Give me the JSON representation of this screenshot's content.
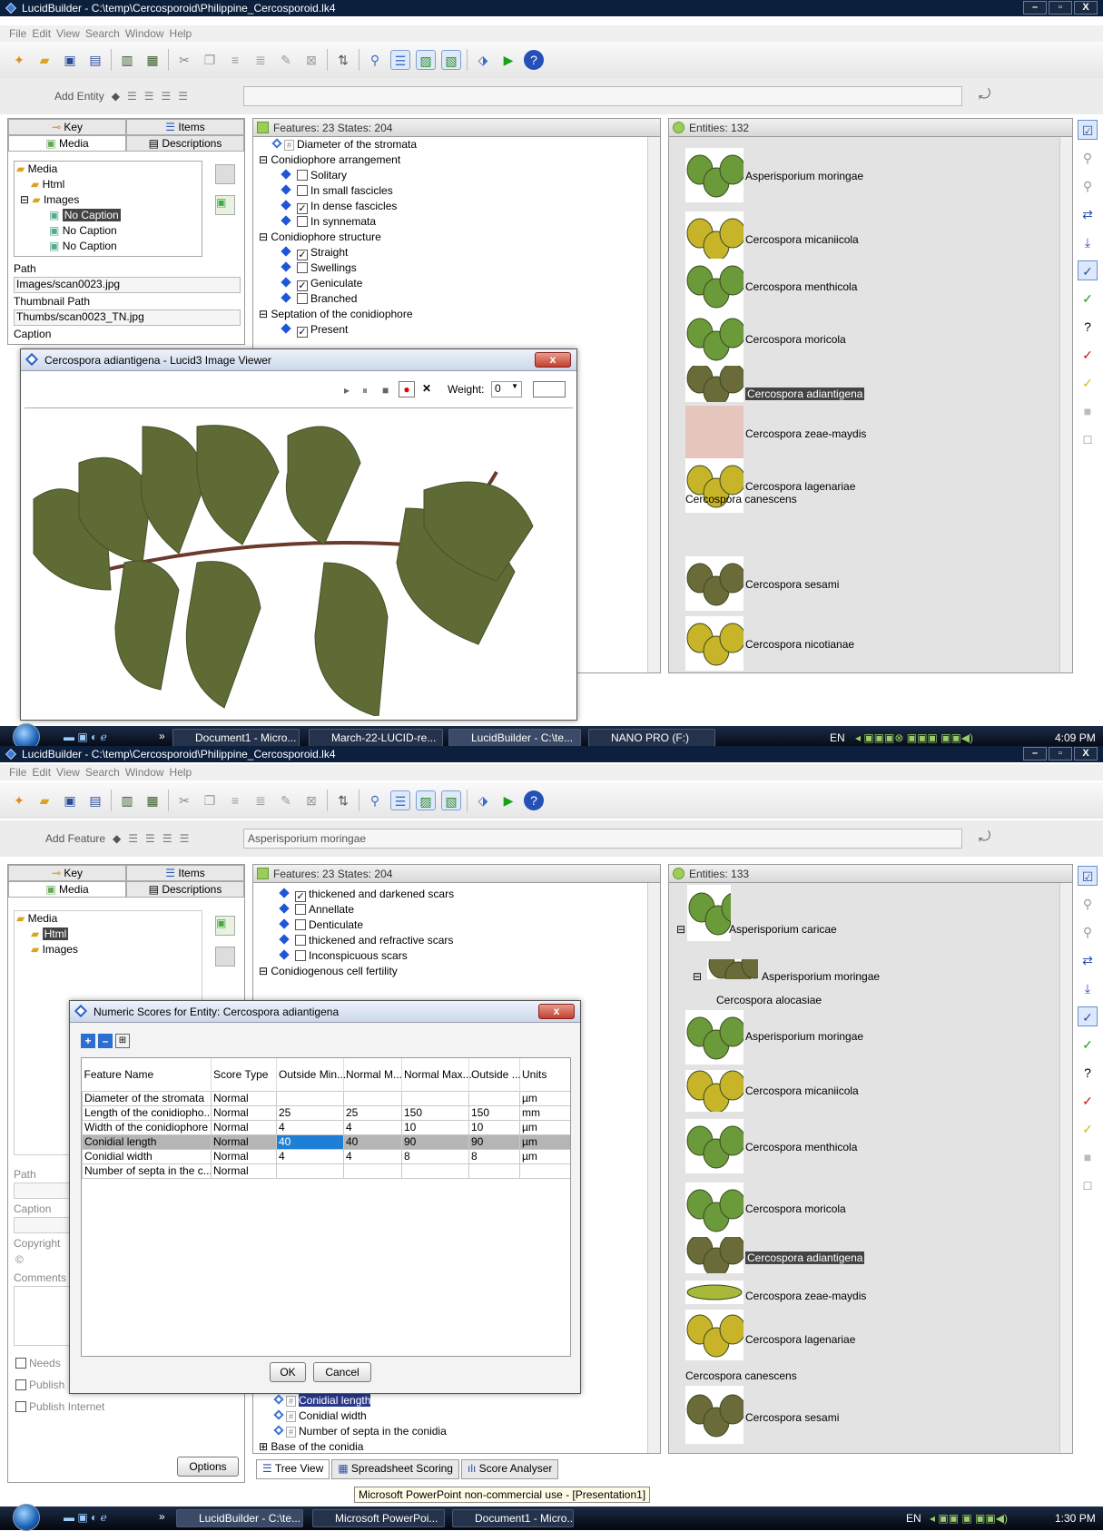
{
  "top": {
    "title": "LucidBuilder - C:\\temp\\Cercosporoid\\Philippine_Cercosporoid.lk4",
    "menu": [
      "File",
      "Edit",
      "View",
      "Search",
      "Window",
      "Help"
    ],
    "entity_bar_label": "Add Entity",
    "left_tabs": {
      "key": "Key",
      "items": "Items",
      "media": "Media",
      "descriptions": "Descriptions"
    },
    "media_tree": [
      "Media",
      "Html",
      "Images",
      "No Caption",
      "No Caption",
      "No Caption"
    ],
    "path_label": "Path",
    "path_value": "Images/scan0023.jpg",
    "thumb_label": "Thumbnail Path",
    "thumb_value": "Thumbs/scan0023_TN.jpg",
    "caption_label": "Caption",
    "features_header": "Features: 23 States: 204",
    "features": [
      {
        "t": "Diameter of the stromata",
        "kind": "numeric",
        "lvl": 1
      },
      {
        "t": "Conidiophore arrangement",
        "kind": "group",
        "lvl": 0
      },
      {
        "t": "Solitary",
        "kind": "state",
        "checked": false,
        "lvl": 2
      },
      {
        "t": "In small fascicles",
        "kind": "state",
        "checked": false,
        "lvl": 2
      },
      {
        "t": "In dense fascicles",
        "kind": "state",
        "checked": true,
        "lvl": 2
      },
      {
        "t": "In synnemata",
        "kind": "state",
        "checked": false,
        "lvl": 2
      },
      {
        "t": "Conidiophore structure",
        "kind": "group",
        "lvl": 0
      },
      {
        "t": "Straight",
        "kind": "state",
        "checked": true,
        "lvl": 2
      },
      {
        "t": "Swellings",
        "kind": "state",
        "checked": false,
        "lvl": 2
      },
      {
        "t": "Geniculate",
        "kind": "state",
        "checked": true,
        "lvl": 2
      },
      {
        "t": "Branched",
        "kind": "state",
        "checked": false,
        "lvl": 2
      },
      {
        "t": "Septation of the conidiophore",
        "kind": "group",
        "lvl": 0
      },
      {
        "t": "Present",
        "kind": "state",
        "checked": true,
        "lvl": 2
      }
    ],
    "entities_header": "Entities: 132",
    "entities": [
      "Asperisporium moringae",
      "Cercospora micaniicola",
      "Cercospora menthicola",
      "Cercospora moricola",
      "Cercospora adiantigena",
      "Cercospora zeae-maydis",
      "Cercospora lagenariae",
      "Cercospora canescens",
      "Cercospora sesami",
      "Cercospora nicotianae"
    ],
    "viewer": {
      "title": "Cercospora adiantigena - Lucid3 Image Viewer",
      "weight_label": "Weight:",
      "weight_value": "0"
    }
  },
  "taskbar1": {
    "items": [
      "Document1 - Micro...",
      "March-22-LUCID-re...",
      "LucidBuilder - C:\\te...",
      "NANO PRO (F:)"
    ],
    "lang": "EN",
    "time": "4:09 PM"
  },
  "bottom": {
    "title": "LucidBuilder - C:\\temp\\Cercosporoid\\Philippine_Cercosporoid.lk4",
    "menu": [
      "File",
      "Edit",
      "View",
      "Search",
      "Window",
      "Help"
    ],
    "feature_bar_label": "Add Feature",
    "feature_bar_value": "Asperisporium moringae",
    "left_tabs": {
      "key": "Key",
      "items": "Items",
      "media": "Media",
      "descriptions": "Descriptions"
    },
    "media_tree": [
      "Media",
      "Html",
      "Images"
    ],
    "path_label": "Path",
    "caption_label": "Caption",
    "copyright_label": "Copyright",
    "copyright_sym": "©",
    "comments_label": "Comments",
    "needs_label": "Needs",
    "publish_label": "Publish",
    "publish_internet": "Publish Internet",
    "options": "Options",
    "features_header": "Features: 23 States: 204",
    "features_top": [
      {
        "t": "thickened and darkened scars",
        "checked": true
      },
      {
        "t": "Annellate",
        "checked": false
      },
      {
        "t": "Denticulate",
        "checked": false
      },
      {
        "t": "thickened and refractive scars",
        "checked": false
      },
      {
        "t": "Inconspicuous scars",
        "checked": false
      }
    ],
    "feature_group": "Conidiogenous cell fertility",
    "features_bottom": [
      "Conidial length",
      "Conidial width",
      "Number of septa in the conidia",
      "Base of the conidia"
    ],
    "bottom_tabs": [
      "Tree View",
      "Spreadsheet Scoring",
      "Score Analyser"
    ],
    "entities_header": "Entities: 133",
    "entities": [
      "Asperisporium caricae",
      "Asperisporium moringae",
      "Cercospora alocasiae",
      "Asperisporium moringae",
      "Cercospora micaniicola",
      "Cercospora menthicola",
      "Cercospora moricola",
      "Cercospora adiantigena",
      "Cercospora zeae-maydis",
      "Cercospora lagenariae",
      "Cercospora canescens",
      "Cercospora sesami"
    ],
    "status": "Microsoft PowerPoint non-commercial use - [Presentation1]",
    "dialog": {
      "title": "Numeric Scores for Entity: Cercospora adiantigena",
      "columns": [
        "Feature Name",
        "Score Type",
        "Outside Min...",
        "Normal M...",
        "Normal Max...",
        "Outside ...",
        "Units"
      ],
      "rows": [
        [
          "Diameter of the stromata",
          "Normal",
          "",
          "",
          "",
          "",
          "µm"
        ],
        [
          "Length of the conidiopho...",
          "Normal",
          "25",
          "25",
          "150",
          "150",
          "mm"
        ],
        [
          "Width of the conidiophore",
          "Normal",
          "4",
          "4",
          "10",
          "10",
          "µm"
        ],
        [
          "Conidial length",
          "Normal",
          "40",
          "40",
          "90",
          "90",
          "µm"
        ],
        [
          "Conidial width",
          "Normal",
          "4",
          "4",
          "8",
          "8",
          "µm"
        ],
        [
          "Number of septa in the c...",
          "Normal",
          "",
          "",
          "",
          "",
          ""
        ]
      ],
      "ok": "OK",
      "cancel": "Cancel"
    }
  },
  "taskbar2": {
    "items": [
      "LucidBuilder - C:\\te...",
      "Microsoft PowerPoi...",
      "Document1 - Micro..."
    ],
    "lang": "EN",
    "time": "1:30 PM"
  }
}
